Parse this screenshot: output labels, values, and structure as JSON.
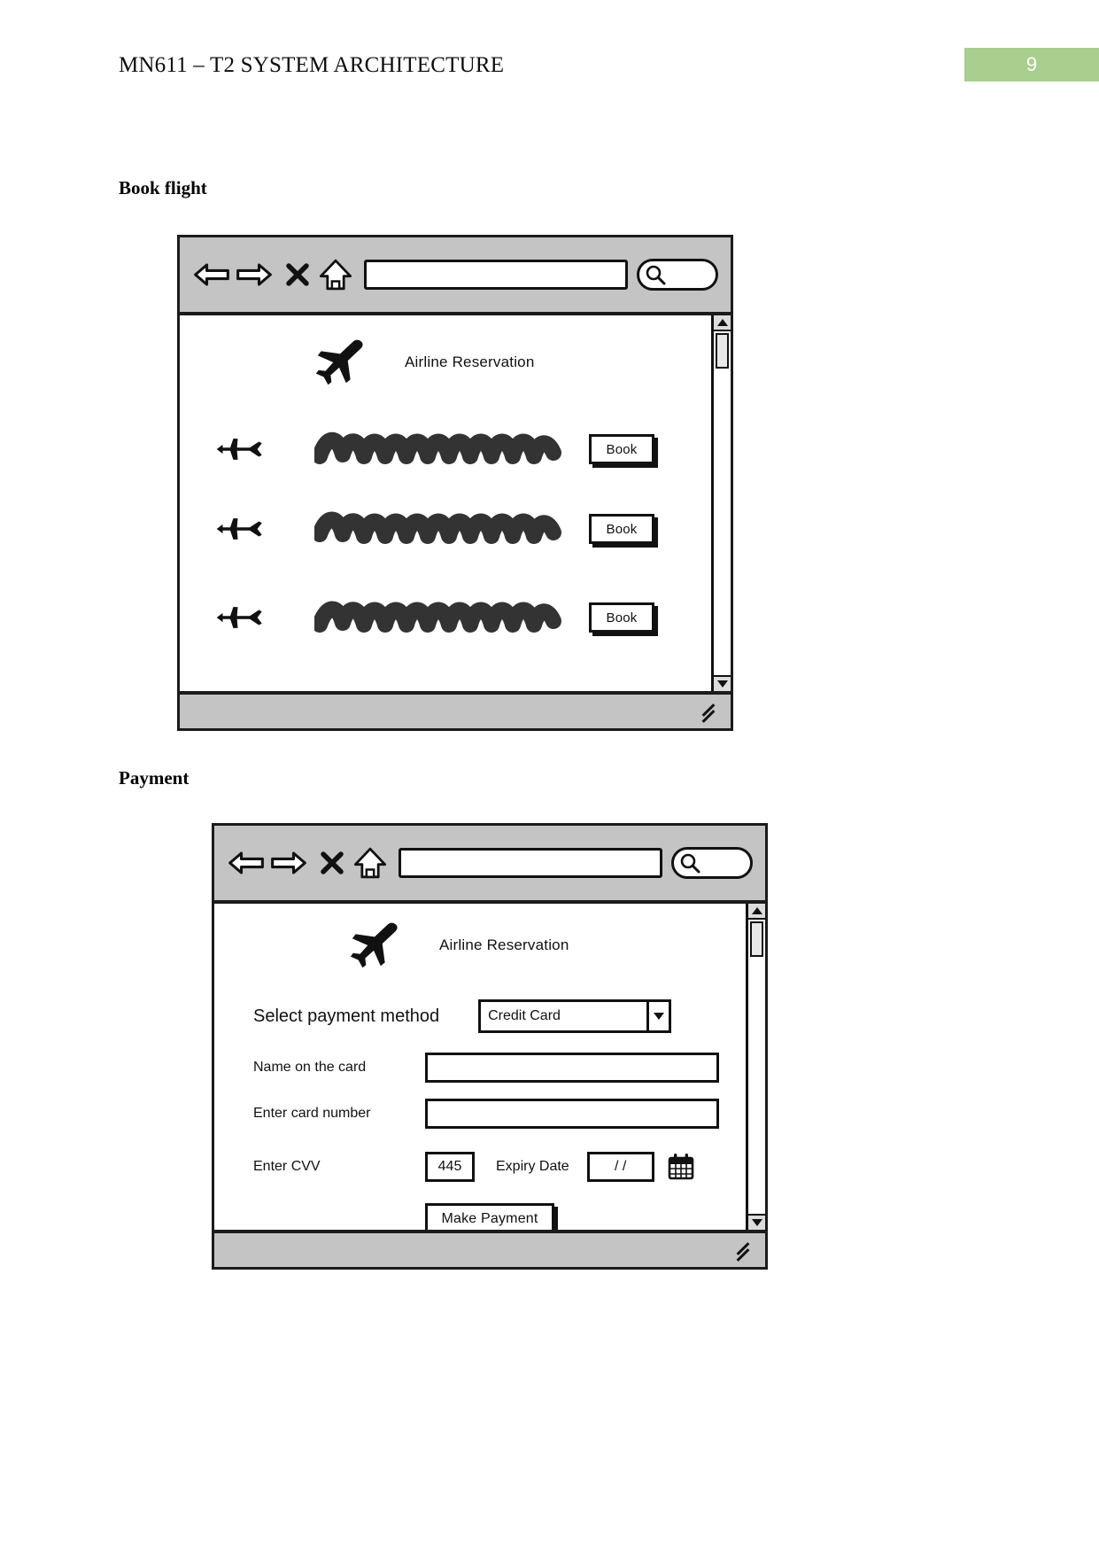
{
  "document": {
    "header_title": "MN611 – T2 SYSTEM ARCHITECTURE",
    "page_number": "9",
    "page_number_color": "#a8cf8e"
  },
  "sections": [
    {
      "heading": "Book flight"
    },
    {
      "heading": "Payment"
    }
  ],
  "browser_chrome": {
    "back_icon": "back-arrow-icon",
    "forward_icon": "forward-arrow-icon",
    "stop_icon": "close-x-icon",
    "home_icon": "home-icon",
    "url_value": "",
    "url_placeholder": "",
    "search_icon": "search-magnifier-icon",
    "search_value": "",
    "scroll_up_icon": "scroll-up-arrow-icon",
    "scroll_down_icon": "scroll-down-arrow-icon",
    "resize_grip_icon": "resize-grip-icon"
  },
  "book_flight": {
    "brand": {
      "logo_icon": "airplane-logo-icon",
      "title": "Airline Reservation"
    },
    "flights": [
      {
        "icon": "jet-icon",
        "description": "",
        "book_label": "Book"
      },
      {
        "icon": "jet-icon",
        "description": "",
        "book_label": "Book"
      },
      {
        "icon": "jet-icon",
        "description": "",
        "book_label": "Book"
      }
    ]
  },
  "payment": {
    "brand": {
      "logo_icon": "airplane-logo-icon",
      "title": "Airline Reservation"
    },
    "payment_method": {
      "label": "Select payment method",
      "selected": "Credit Card",
      "caret_icon": "chevron-down-icon"
    },
    "name_on_card": {
      "label": "Name on the card",
      "value": "",
      "placeholder": ""
    },
    "card_number": {
      "label": "Enter card number",
      "value": "",
      "placeholder": ""
    },
    "cvv": {
      "label": "Enter CVV",
      "value": "445"
    },
    "expiry": {
      "label": "Expiry Date",
      "value": "/ /",
      "calendar_icon": "calendar-icon"
    },
    "submit_label": "Make Payment"
  }
}
